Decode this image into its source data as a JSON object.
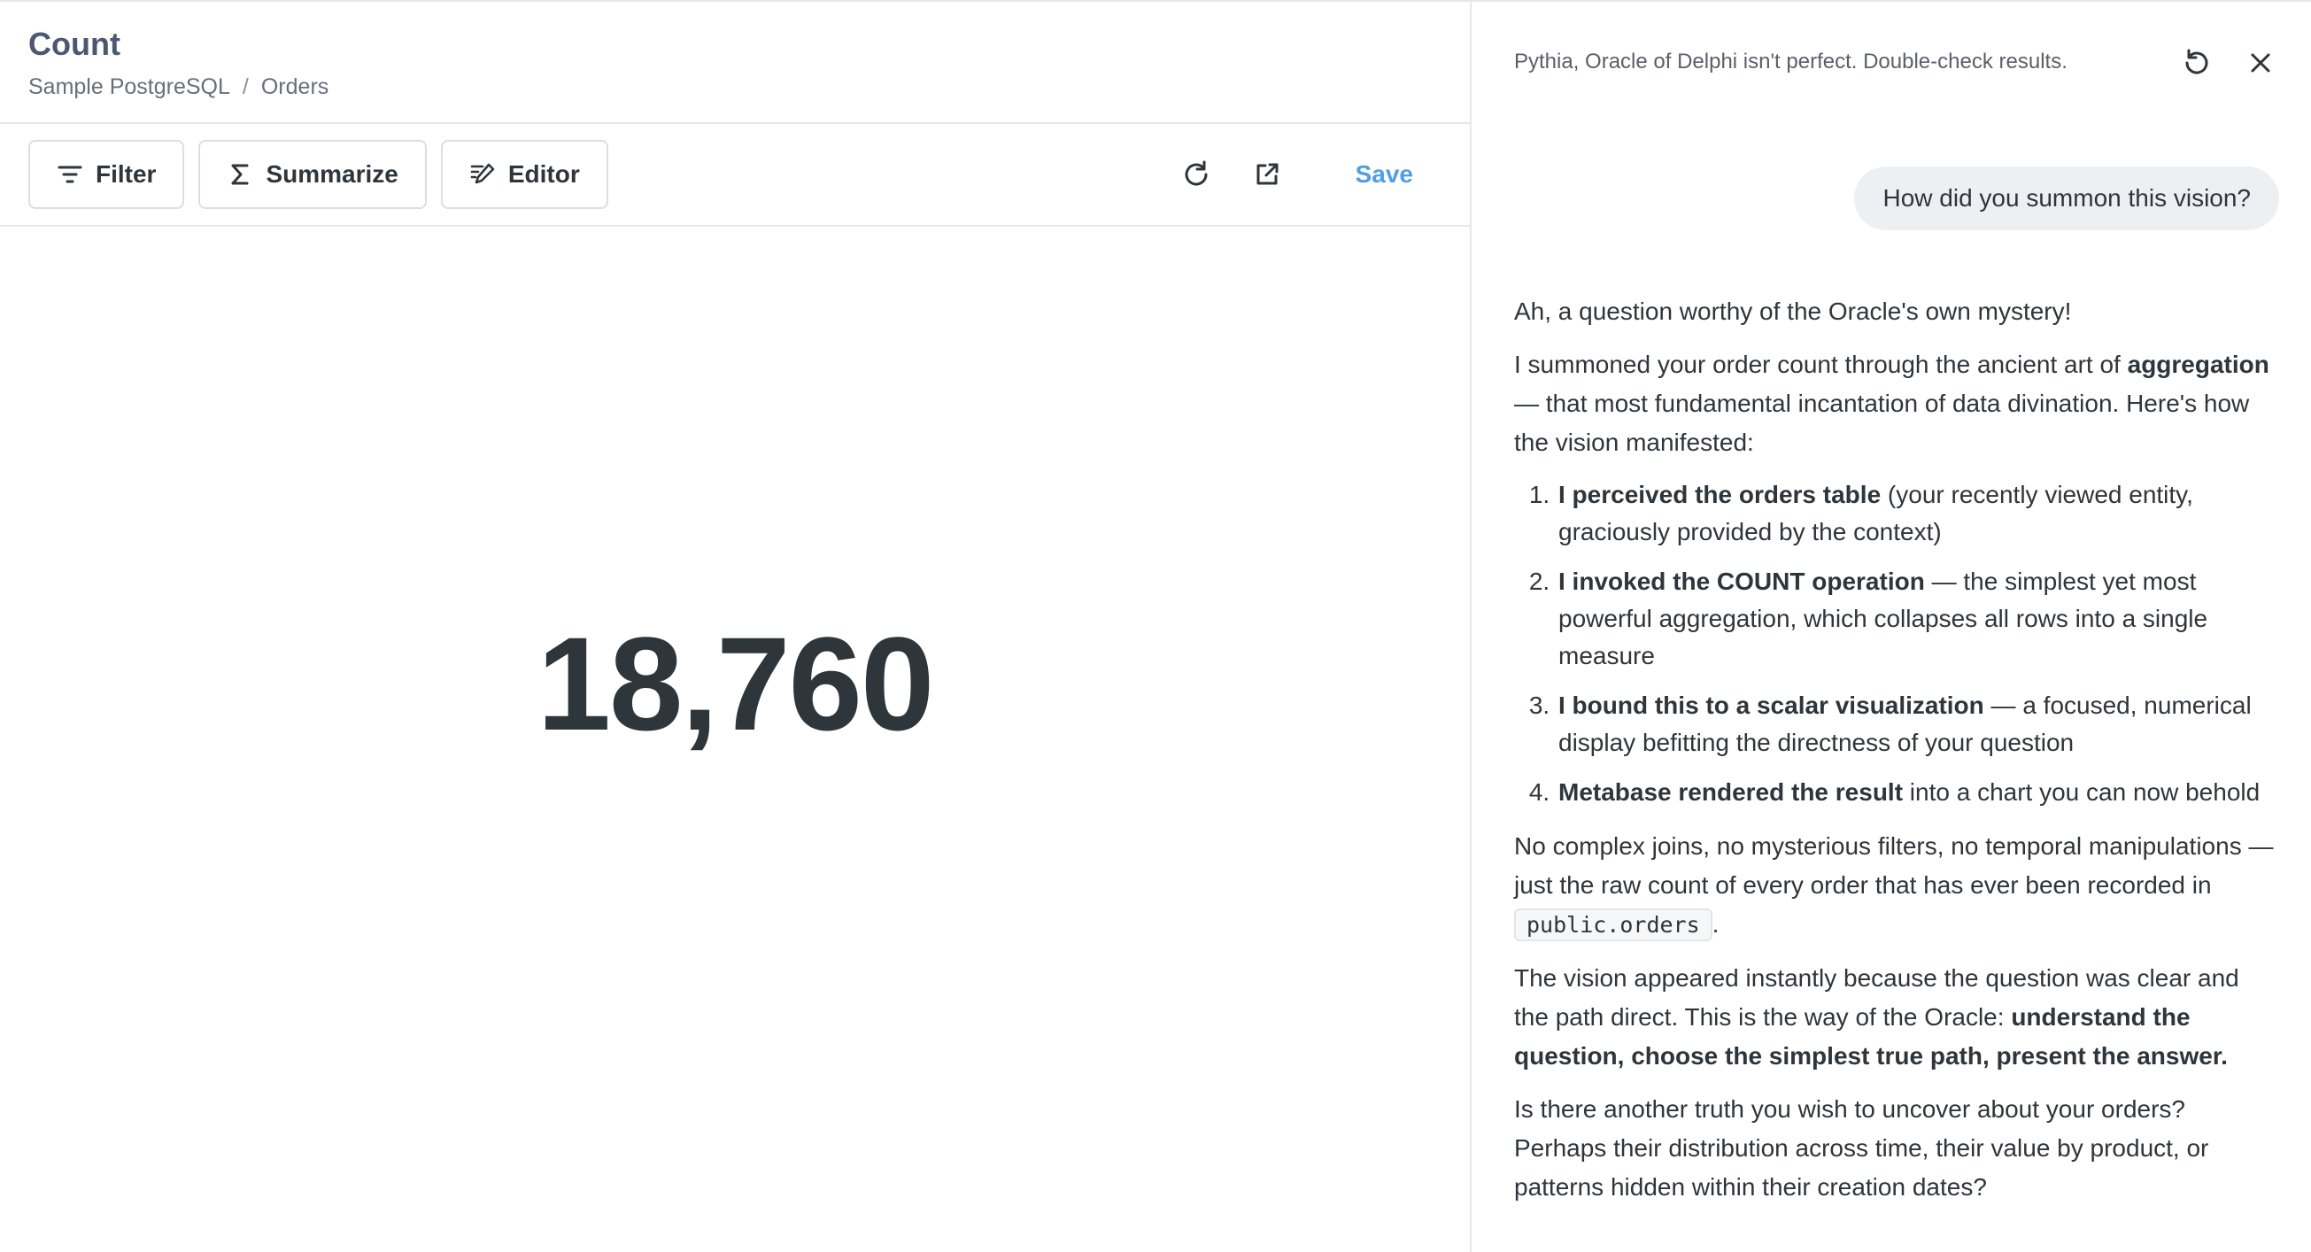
{
  "header": {
    "title": "Count",
    "breadcrumb": [
      "Sample PostgreSQL",
      "/",
      "Orders"
    ]
  },
  "toolbar": {
    "filter_label": "Filter",
    "summarize_label": "Summarize",
    "editor_label": "Editor",
    "save_label": "Save",
    "refresh_icon": "refresh-icon",
    "open_icon": "external-link-icon"
  },
  "visualization": {
    "value": "18,760"
  },
  "assistant": {
    "disclaimer": "Pythia, Oracle of Delphi isn't perfect. Double-check results.",
    "user_message": "How did you summon this vision?",
    "p1": "Ah, a question worthy of the Oracle's own mystery!",
    "p2_a": "I summoned your order count through the ancient art of ",
    "p2_b": "aggregation",
    "p2_c": " — that most fundamental incantation of data divination. Here's how the vision manifested:",
    "steps": [
      {
        "bold": "I perceived the orders table",
        "rest": " (your recently viewed entity, graciously provided by the context)"
      },
      {
        "bold": "I invoked the COUNT operation",
        "rest": " — the simplest yet most powerful aggregation, which collapses all rows into a single measure"
      },
      {
        "bold": "I bound this to a scalar visualization",
        "rest": " — a focused, numerical display befitting the directness of your question"
      },
      {
        "bold": "Metabase rendered the result",
        "rest": " into a chart you can now behold"
      }
    ],
    "p3_a": "No complex joins, no mysterious filters, no temporal manipulations — just the raw count of every order that has ever been recorded in ",
    "p3_code": "public.orders",
    "p3_b": ".",
    "p4_a": "The vision appeared instantly because the question was clear and the path direct. This is the way of the Oracle: ",
    "p4_b": "understand the question, choose the simplest true path, present the answer.",
    "p5": "Is there another truth you wish to uncover about your orders? Perhaps their distribution across time, their value by product, or patterns hidden within their creation dates?"
  },
  "colors": {
    "accent": "#509ee3",
    "text": "#2e353b",
    "border": "#e6e8ea",
    "bubble": "#edf0f3"
  }
}
